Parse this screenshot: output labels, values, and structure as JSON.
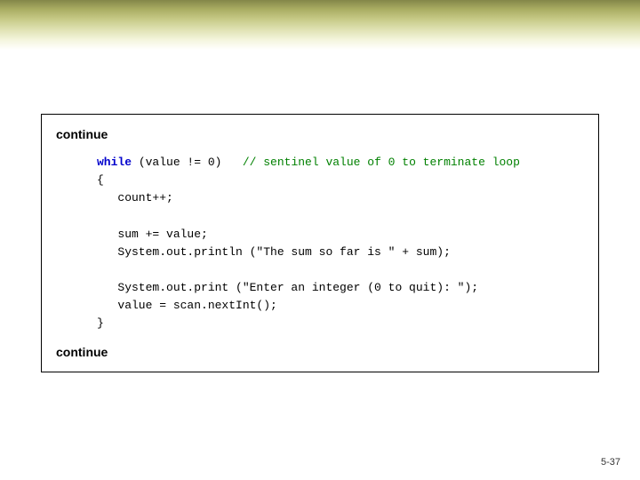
{
  "labels": {
    "continue_top": "continue",
    "continue_bottom": "continue"
  },
  "code": {
    "kw_while": "while",
    "cond": " (value != 0)   ",
    "comment": "// sentinel value of 0 to terminate loop",
    "l_brace": "{",
    "l_count": "   count++;",
    "l_blank1": "",
    "l_sum": "   sum += value;",
    "l_print1": "   System.out.println (\"The sum so far is \" + sum);",
    "l_blank2": "",
    "l_print2": "   System.out.print (\"Enter an integer (0 to quit): \");",
    "l_scan": "   value = scan.nextInt();",
    "r_brace": "}"
  },
  "page_number": "5-37"
}
